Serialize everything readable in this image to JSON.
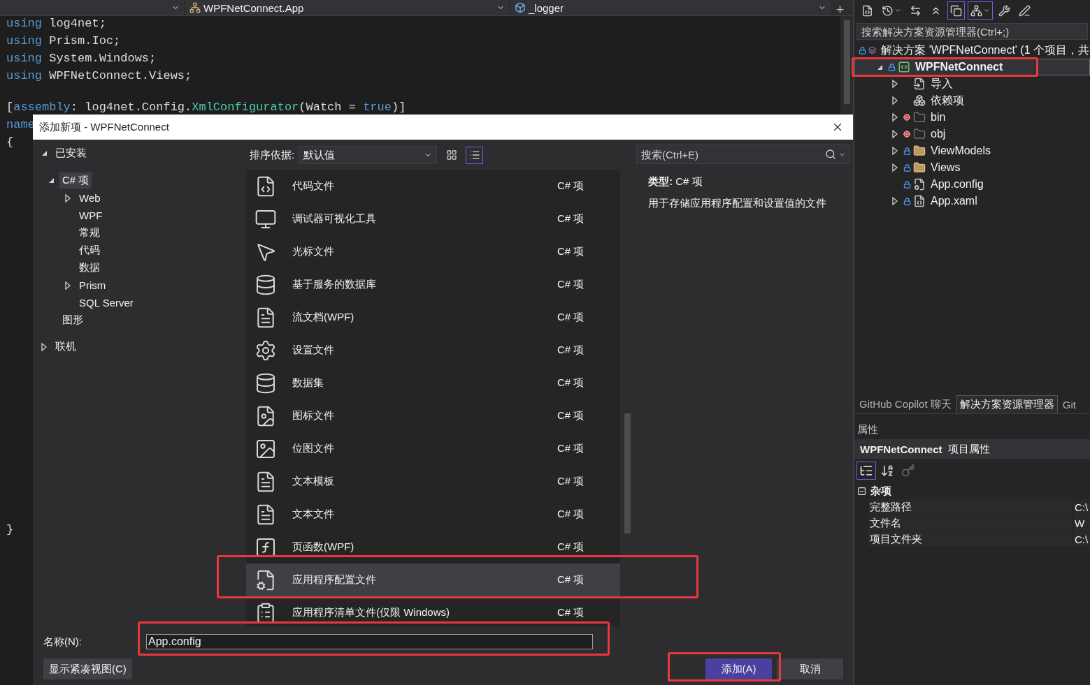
{
  "editor": {
    "nav": {
      "class_dropdown": "WPFNetConnect.App",
      "member_dropdown": "_logger"
    },
    "lines": [
      {
        "tokens": [
          {
            "kind": "keyword",
            "text": "using"
          },
          {
            "kind": "plain",
            "text": " log4net;"
          }
        ]
      },
      {
        "tokens": [
          {
            "kind": "keyword",
            "text": "using"
          },
          {
            "kind": "plain",
            "text": " Prism.Ioc;"
          }
        ]
      },
      {
        "tokens": [
          {
            "kind": "keyword",
            "text": "using"
          },
          {
            "kind": "plain",
            "text": " System.Windows;"
          }
        ]
      },
      {
        "tokens": [
          {
            "kind": "keyword",
            "text": "using"
          },
          {
            "kind": "plain",
            "text": " WPFNetConnect.Views;"
          }
        ]
      },
      {
        "gap_before": true,
        "tokens": [
          {
            "kind": "plain",
            "text": "["
          },
          {
            "kind": "keyword",
            "text": "assembly"
          },
          {
            "kind": "plain",
            "text": ": log4net.Config."
          },
          {
            "kind": "type",
            "text": "XmlConfigurator"
          },
          {
            "kind": "plain",
            "text": "(Watch = "
          },
          {
            "kind": "keyword",
            "text": "true"
          },
          {
            "kind": "plain",
            "text": ")]"
          }
        ]
      },
      {
        "tokens": [
          {
            "kind": "keyword",
            "text": "name"
          }
        ]
      },
      {
        "tokens": [
          {
            "kind": "plain",
            "text": "{"
          }
        ]
      }
    ],
    "end_lines": [
      {
        "tokens": [
          {
            "kind": "plain",
            "text": "}"
          }
        ]
      }
    ]
  },
  "dialog": {
    "title": "添加新项 - WPFNetConnect",
    "categories": [
      {
        "label": "已安装",
        "expanded": true,
        "selected": false,
        "children": [
          {
            "label": "C# 项",
            "expanded": true,
            "selected": true,
            "children": [
              {
                "label": "Web",
                "expanded": false,
                "selected": false
              },
              {
                "label": "WPF",
                "selected": false
              },
              {
                "label": "常规",
                "selected": false
              },
              {
                "label": "代码",
                "selected": false
              },
              {
                "label": "数据",
                "selected": false
              },
              {
                "label": "Prism",
                "expanded": false,
                "selected": false
              },
              {
                "label": "SQL Server",
                "selected": false
              }
            ]
          },
          {
            "label": "图形",
            "selected": false
          }
        ]
      },
      {
        "label": "联机",
        "expanded": false,
        "selected": false
      }
    ],
    "sort": {
      "label": "排序依据:",
      "value": "默认值"
    },
    "views": [
      {
        "kind": "grid",
        "selected": false
      },
      {
        "kind": "list",
        "selected": true
      }
    ],
    "search": {
      "placeholder": "搜索(Ctrl+E)"
    },
    "templates": [
      {
        "kind": "code",
        "name": "代码文件",
        "type": "C# 项",
        "selected": false,
        "marked": false
      },
      {
        "kind": "debugger",
        "name": "调试器可视化工具",
        "type": "C# 项",
        "selected": false,
        "marked": false
      },
      {
        "kind": "cursor",
        "name": "光标文件",
        "type": "C# 项",
        "selected": false,
        "marked": false
      },
      {
        "kind": "database",
        "name": "基于服务的数据库",
        "type": "C# 项",
        "selected": false,
        "marked": false
      },
      {
        "kind": "flowdoc",
        "name": "流文档(WPF)",
        "type": "C# 项",
        "selected": false,
        "marked": false
      },
      {
        "kind": "settings",
        "name": "设置文件",
        "type": "C# 项",
        "selected": false,
        "marked": false
      },
      {
        "kind": "dataset",
        "name": "数据集",
        "type": "C# 项",
        "selected": false,
        "marked": false
      },
      {
        "kind": "iconfile",
        "name": "图标文件",
        "type": "C# 项",
        "selected": false,
        "marked": false
      },
      {
        "kind": "bitmap",
        "name": "位图文件",
        "type": "C# 项",
        "selected": false,
        "marked": false
      },
      {
        "kind": "texttemplate",
        "name": "文本模板",
        "type": "C# 项",
        "selected": false,
        "marked": false
      },
      {
        "kind": "textfile",
        "name": "文本文件",
        "type": "C# 项",
        "selected": false,
        "marked": false
      },
      {
        "kind": "pagefunction",
        "name": "页函数(WPF)",
        "type": "C# 项",
        "selected": false,
        "marked": false
      },
      {
        "kind": "appconfig",
        "name": "应用程序配置文件",
        "type": "C# 项",
        "selected": true,
        "marked": true
      },
      {
        "kind": "manifest",
        "name": "应用程序清单文件(仅限 Windows)",
        "type": "C# 项",
        "selected": false,
        "marked": false
      }
    ],
    "details": {
      "type": "**类型:** C# 项",
      "description": "用于存储应用程序配置和设置值的文件"
    },
    "name_field": {
      "label": "名称(N):",
      "value": "App.config",
      "marked": true
    },
    "compact_button": "显示紧凑视图(C)",
    "buttons": [
      {
        "kind": "primary",
        "label": "添加(A)",
        "marked": true
      },
      {
        "kind": "secondary",
        "label": "取消",
        "marked": false
      }
    ]
  },
  "explorer": {
    "toolbar": [
      {
        "kind": "document",
        "on": false,
        "dropdown": false
      },
      {
        "kind": "history",
        "on": false,
        "dropdown": true
      },
      {
        "kind": "sync",
        "on": false,
        "dropdown": false
      },
      {
        "kind": "collapse",
        "on": false,
        "dropdown": false
      },
      {
        "kind": "copies",
        "on": true,
        "dropdown": false
      },
      {
        "kind": "tree",
        "on": true,
        "dropdown": true
      },
      {
        "kind": "wrench",
        "on": false,
        "dropdown": false
      },
      {
        "kind": "pending",
        "on": false,
        "dropdown": false
      }
    ],
    "search": {
      "placeholder": "搜索解决方案资源管理器(Ctrl+;)"
    },
    "tree": [
      {
        "label": "解决方案 'WPFNetConnect' (1 个项目，共",
        "kind": "solution",
        "locked": true,
        "excluded": false,
        "selected": false,
        "marked": false,
        "children": [
          {
            "label": "WPFNetConnect",
            "kind": "csproj",
            "locked": true,
            "excluded": false,
            "expanded": true,
            "selected": true,
            "marked": true,
            "children": [
              {
                "label": "导入",
                "kind": "import",
                "locked": false,
                "excluded": false,
                "expanded": false,
                "selected": false,
                "marked": false
              },
              {
                "label": "依赖项",
                "kind": "dependencies",
                "locked": false,
                "excluded": false,
                "expanded": false,
                "selected": false,
                "marked": false
              },
              {
                "label": "bin",
                "kind": "excluded-folder",
                "locked": false,
                "excluded": true,
                "expanded": false,
                "selected": false,
                "marked": false
              },
              {
                "label": "obj",
                "kind": "excluded-folder",
                "locked": false,
                "excluded": true,
                "expanded": false,
                "selected": false,
                "marked": false
              },
              {
                "label": "ViewModels",
                "kind": "folder",
                "locked": true,
                "excluded": false,
                "expanded": false,
                "selected": false,
                "marked": false
              },
              {
                "label": "Views",
                "kind": "folder",
                "locked": true,
                "excluded": false,
                "expanded": false,
                "selected": false,
                "marked": false
              },
              {
                "label": "App.config",
                "kind": "config",
                "locked": true,
                "excluded": false,
                "selected": false,
                "marked": false
              },
              {
                "label": "App.xaml",
                "kind": "xaml",
                "locked": true,
                "excluded": false,
                "expanded": false,
                "selected": false,
                "marked": false
              }
            ]
          }
        ]
      }
    ],
    "tabs": [
      {
        "label": "GitHub Copilot 聊天",
        "selected": false
      },
      {
        "label": "解决方案资源管理器",
        "selected": true
      },
      {
        "label": "Git",
        "selected": false
      }
    ]
  },
  "properties": {
    "title": "属性",
    "object_name": "WPFNetConnect",
    "object_type": "项目属性",
    "toolbar": [
      {
        "kind": "categorized",
        "on": true,
        "disabled": false
      },
      {
        "kind": "alphabetical",
        "on": false,
        "disabled": false
      },
      {
        "kind": "property-pages",
        "on": false,
        "disabled": true
      }
    ],
    "categories": [
      {
        "label": "杂项",
        "expanded": true,
        "rows": [
          {
            "name": "完整路径",
            "value": "C:\\"
          },
          {
            "name": "文件名",
            "value": "W"
          },
          {
            "name": "项目文件夹",
            "value": "C:\\"
          }
        ]
      }
    ]
  }
}
